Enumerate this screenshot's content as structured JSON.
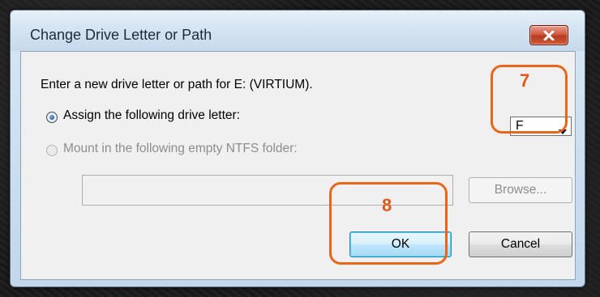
{
  "dialog": {
    "title": "Change Drive Letter or Path",
    "instruction": "Enter a new drive letter or path for E: (VIRTIUM).",
    "options": [
      {
        "label": "Assign the following drive letter:",
        "selected": true,
        "enabled": true
      },
      {
        "label": "Mount in the following empty NTFS folder:",
        "selected": false,
        "enabled": false
      }
    ],
    "drive_letter": {
      "value": "F"
    },
    "folder_path": {
      "value": ""
    },
    "buttons": {
      "browse": "Browse...",
      "ok": "OK",
      "cancel": "Cancel"
    }
  },
  "annotations": [
    {
      "number": "7",
      "color": "#e8661c"
    },
    {
      "number": "8",
      "color": "#e8661c"
    }
  ],
  "icons": {
    "close": "close-icon",
    "dropdown": "chevron-down-icon"
  }
}
